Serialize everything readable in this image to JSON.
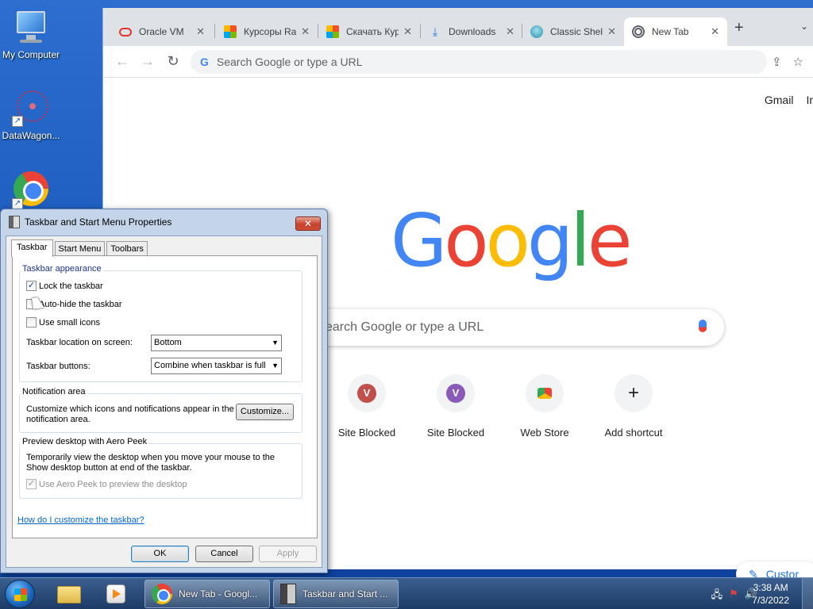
{
  "desktop": {
    "icons": [
      {
        "label": "My Computer"
      },
      {
        "label": "DataWagon..."
      },
      {
        "label": ""
      }
    ]
  },
  "browser": {
    "tabs": [
      {
        "title": "Oracle VM",
        "icon": "oracle-icon",
        "color": "#e0362c",
        "active": false
      },
      {
        "title": "Курсоры Ra",
        "icon": "windows-icon",
        "color": "#f25022",
        "active": false
      },
      {
        "title": "Скачать Кур",
        "icon": "windows-icon",
        "color": "#f25022",
        "active": false
      },
      {
        "title": "Downloads",
        "icon": "download-icon",
        "color": "#1a73e8",
        "active": false
      },
      {
        "title": "Classic Shel",
        "icon": "shell-icon",
        "color": "#3aa0b8",
        "active": false
      },
      {
        "title": "New Tab",
        "icon": "chrome-icon",
        "color": "#5f6368",
        "active": true
      }
    ],
    "omnibox_placeholder": "Search Google or type a URL",
    "ntp": {
      "links": [
        "Gmail",
        "Ir"
      ],
      "logo_letters": [
        "G",
        "o",
        "o",
        "g",
        "l",
        "e"
      ],
      "search_placeholder": "earch Google or type a URL",
      "shortcuts": [
        {
          "label": "Site Blocked",
          "letter": "V",
          "color": "#c0504d"
        },
        {
          "label": "Site Blocked",
          "letter": "V",
          "color": "#8a5ab8"
        },
        {
          "label": "Web Store",
          "letter": "",
          "color": ""
        },
        {
          "label": "Add shortcut",
          "letter": "+",
          "color": ""
        }
      ],
      "customize_label": "Custor"
    }
  },
  "dialog": {
    "title": "Taskbar and Start Menu Properties",
    "close": "✕",
    "tabs": [
      "Taskbar",
      "Start Menu",
      "Toolbars"
    ],
    "appearance": {
      "title": "Taskbar appearance",
      "lock": {
        "label": "Lock the taskbar",
        "checked": true
      },
      "autohide": {
        "label": "Auto-hide the taskbar",
        "checked": false
      },
      "small_icons": {
        "label": "Use small icons",
        "checked": false
      },
      "location_label": "Taskbar location on screen:",
      "location_value": "Bottom",
      "buttons_label": "Taskbar buttons:",
      "buttons_value": "Combine when taskbar is full"
    },
    "notification": {
      "title": "Notification area",
      "text": "Customize which icons and notifications appear in the notification area.",
      "button": "Customize..."
    },
    "aero": {
      "title": "Preview desktop with Aero Peek",
      "text": "Temporarily view the desktop when you move your mouse to the Show desktop button at end of the taskbar.",
      "checkbox": {
        "label": "Use Aero Peek to preview the desktop",
        "checked": true
      }
    },
    "help_link": "How do I customize the taskbar?",
    "buttons": {
      "ok": "OK",
      "cancel": "Cancel",
      "apply": "Apply"
    }
  },
  "taskbar": {
    "tasks": [
      {
        "label": "New Tab - Googl..."
      },
      {
        "label": "Taskbar and Start ..."
      }
    ],
    "clock": {
      "time": "3:38 AM",
      "date": "7/3/2022"
    }
  }
}
